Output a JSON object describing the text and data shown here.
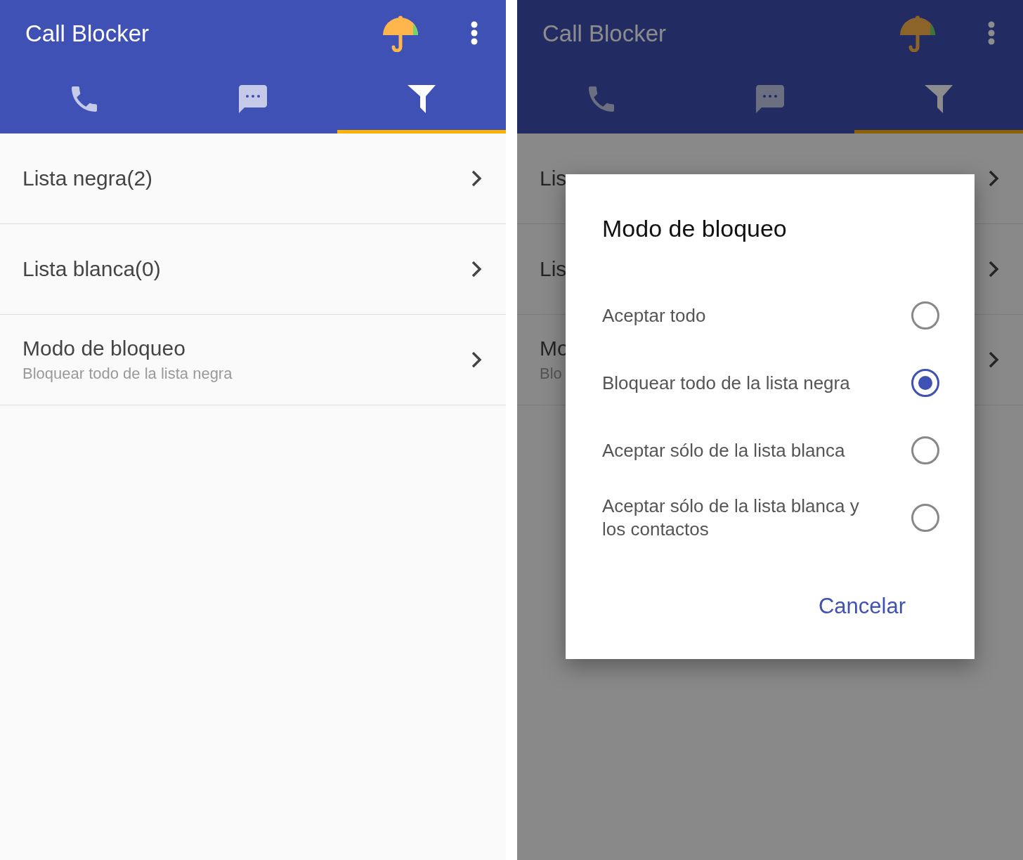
{
  "screens": [
    {
      "app_title": "Call Blocker",
      "dimmed": false,
      "tabs": [
        {
          "kind": "phone",
          "selected": false
        },
        {
          "kind": "message",
          "selected": false
        },
        {
          "kind": "filter",
          "selected": true
        }
      ],
      "rows": [
        {
          "title": "Lista negra(2)"
        },
        {
          "title": "Lista blanca(0)"
        },
        {
          "title": "Modo de bloqueo",
          "subtitle": "Bloquear todo de la lista negra"
        }
      ]
    },
    {
      "app_title": "Call Blocker",
      "dimmed": true,
      "tabs": [
        {
          "kind": "phone",
          "selected": false
        },
        {
          "kind": "message",
          "selected": false
        },
        {
          "kind": "filter",
          "selected": true
        }
      ],
      "rows": [
        {
          "title": "Lis"
        },
        {
          "title": "Lis"
        },
        {
          "title": "Mo",
          "subtitle": "Blo"
        }
      ],
      "dialog": {
        "title": "Modo de bloqueo",
        "options": [
          {
            "label": "Aceptar todo",
            "selected": false
          },
          {
            "label": "Bloquear todo de la lista negra",
            "selected": true
          },
          {
            "label": "Aceptar sólo de la lista blanca",
            "selected": false
          },
          {
            "label": "Aceptar sólo de la lista blanca y los contactos",
            "selected": false
          }
        ],
        "button": "Cancelar"
      }
    }
  ]
}
